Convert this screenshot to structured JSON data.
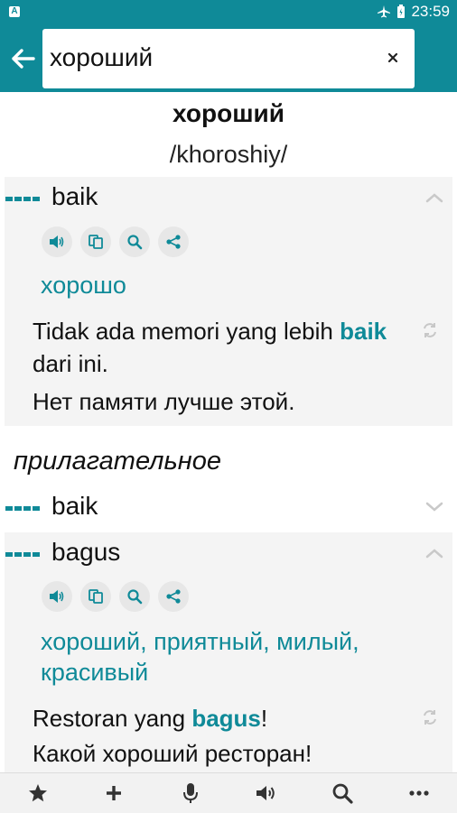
{
  "status_bar": {
    "time": "23:59",
    "app_badge": "A"
  },
  "search": {
    "value": "хороший",
    "placeholder": ""
  },
  "entry": {
    "headword": "хороший",
    "transliteration": "/khoroshiy/",
    "senses": [
      {
        "word": "baik",
        "translations": "хорошо",
        "example_before": "Tidak ada memori yang lebih ",
        "example_bold": "baik",
        "example_after": " dari ini.",
        "example_translation": "Нет памяти лучше этой."
      }
    ],
    "part_of_speech": "прилагательное",
    "pos_senses": [
      {
        "word": "baik"
      },
      {
        "word": "bagus",
        "translations": "хороший, приятный, милый, красивый",
        "example_before": "Restoran yang ",
        "example_bold": "bagus",
        "example_after": "!",
        "example_translation": "Какой хороший ресторан!"
      }
    ]
  },
  "icons": {
    "back": "arrow-left-icon",
    "clear": "close-icon",
    "speak": "speaker-icon",
    "copy": "copy-icon",
    "search": "search-icon",
    "share": "share-icon",
    "refresh": "refresh-icon",
    "nav": [
      "star-icon",
      "plus-icon",
      "mic-icon",
      "speaker-icon",
      "search-icon",
      "more-icon"
    ]
  },
  "colors": {
    "accent": "#0f8a98",
    "card_bg": "#f4f4f4"
  }
}
